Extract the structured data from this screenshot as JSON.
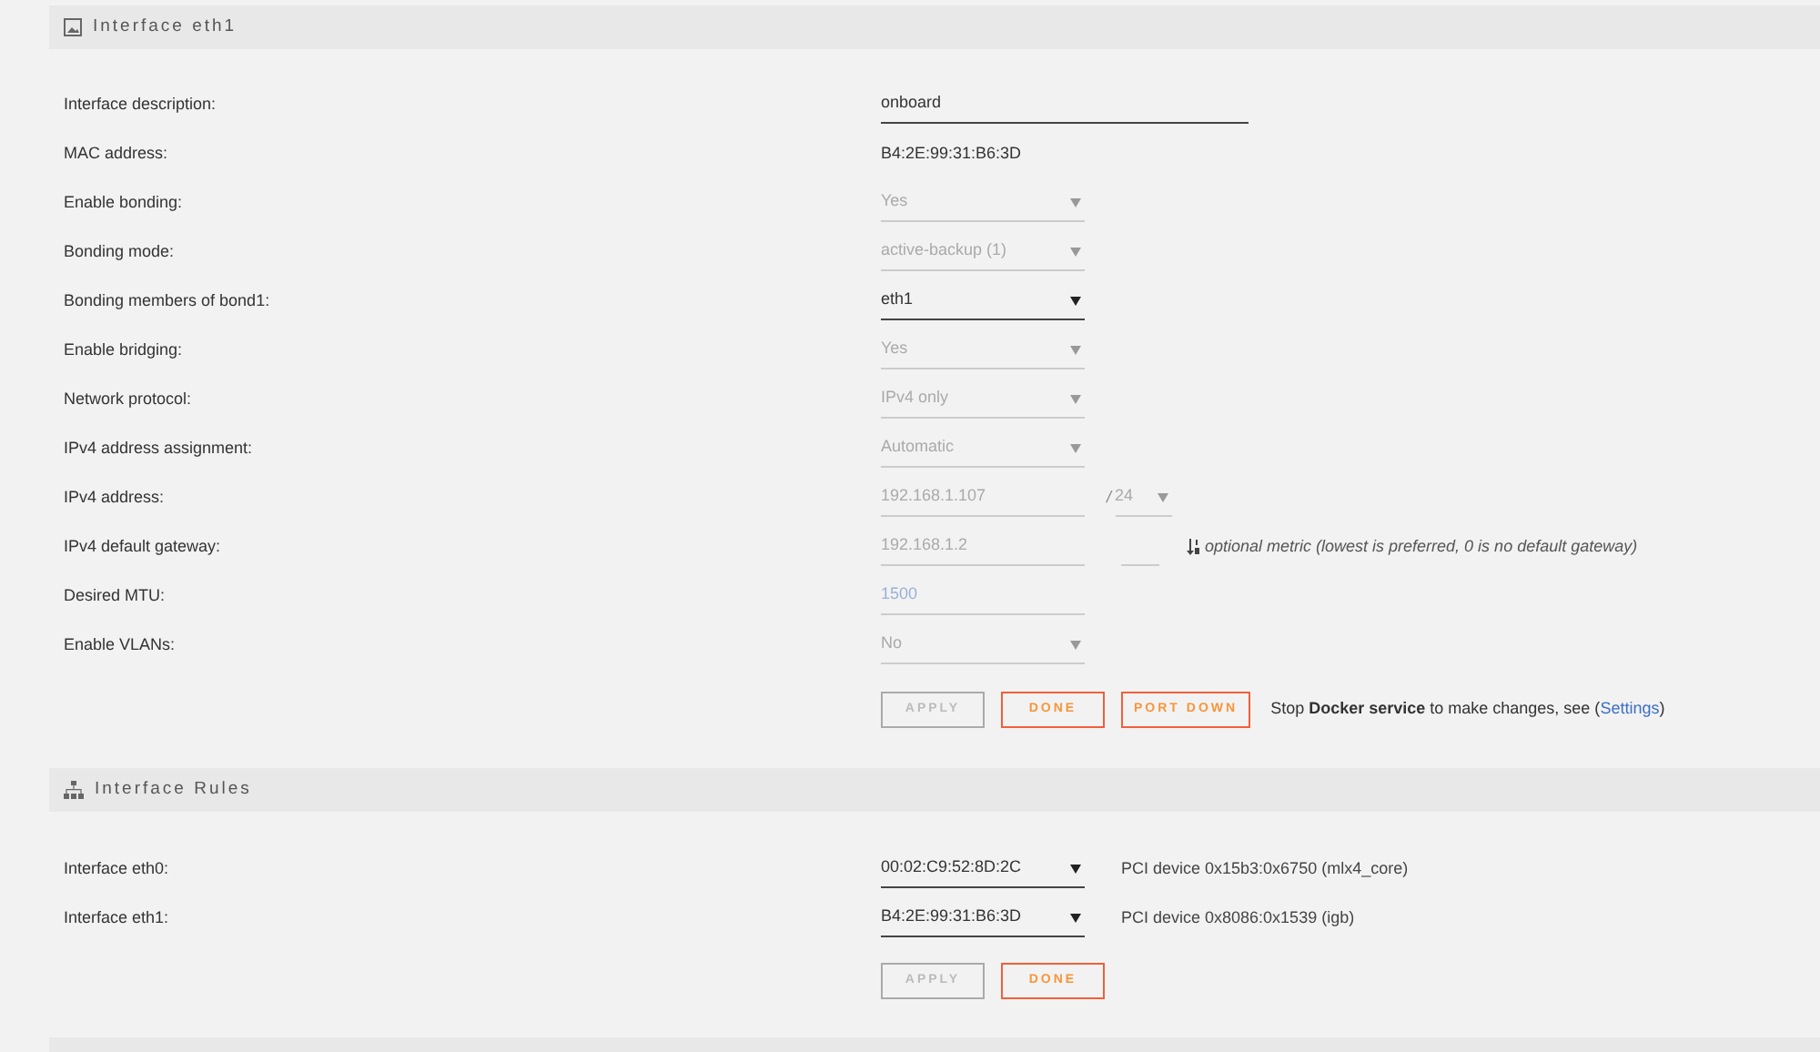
{
  "sections": [
    {
      "title": "Interface eth1",
      "rows": [
        {
          "label": "Interface description:",
          "kind": "text",
          "value": "onboard",
          "disabled": false
        },
        {
          "label": "MAC address:",
          "kind": "static",
          "value": "B4:2E:99:31:B6:3D"
        },
        {
          "label": "Enable bonding:",
          "kind": "select",
          "value": "Yes",
          "disabled": true
        },
        {
          "label": "Bonding mode:",
          "kind": "select",
          "value": "active-backup (1)",
          "disabled": true
        },
        {
          "label": "Bonding members of bond1:",
          "kind": "select",
          "value": "eth1",
          "disabled": false
        },
        {
          "label": "Enable bridging:",
          "kind": "select",
          "value": "Yes",
          "disabled": true
        },
        {
          "label": "Network protocol:",
          "kind": "select",
          "value": "IPv4 only",
          "disabled": true
        },
        {
          "label": "IPv4 address assignment:",
          "kind": "select",
          "value": "Automatic",
          "disabled": true
        },
        {
          "label": "IPv4 address:",
          "kind": "input",
          "value": "192.168.1.107",
          "disabled": true,
          "netmask": {
            "separator": "/",
            "value": "24",
            "disabled": true
          }
        },
        {
          "label": "IPv4 default gateway:",
          "kind": "input",
          "value": "192.168.1.2",
          "disabled": true,
          "metric": {
            "hint": "optional metric (lowest is preferred, 0 is no default gateway)"
          }
        },
        {
          "label": "Desired MTU:",
          "kind": "input",
          "placeholder": "1500",
          "disabled": true
        },
        {
          "label": "Enable VLANs:",
          "kind": "select",
          "value": "No",
          "disabled": true
        }
      ],
      "buttons": [
        {
          "label": "APPLY",
          "disabled": true
        },
        {
          "label": "DONE",
          "disabled": false
        },
        {
          "label": "PORT DOWN",
          "disabled": false
        }
      ],
      "note": {
        "text": "Stop **Docker service** to make changes, see (",
        "link": "Settings",
        "end": ")"
      }
    },
    {
      "title": "Interface Rules",
      "rows": [
        {
          "label": "Interface eth0:",
          "kind": "select",
          "value": "00:02:C9:52:8D:2C",
          "disabled": false,
          "info": "PCI device 0x15b3:0x6750 (mlx4_core)"
        },
        {
          "label": "Interface eth1:",
          "kind": "select",
          "value": "B4:2E:99:31:B6:3D",
          "disabled": false,
          "info": "PCI device 0x8086:0x1539 (igb)"
        }
      ],
      "buttons": [
        {
          "label": "APPLY",
          "disabled": true
        },
        {
          "label": "DONE",
          "disabled": false
        }
      ]
    }
  ]
}
